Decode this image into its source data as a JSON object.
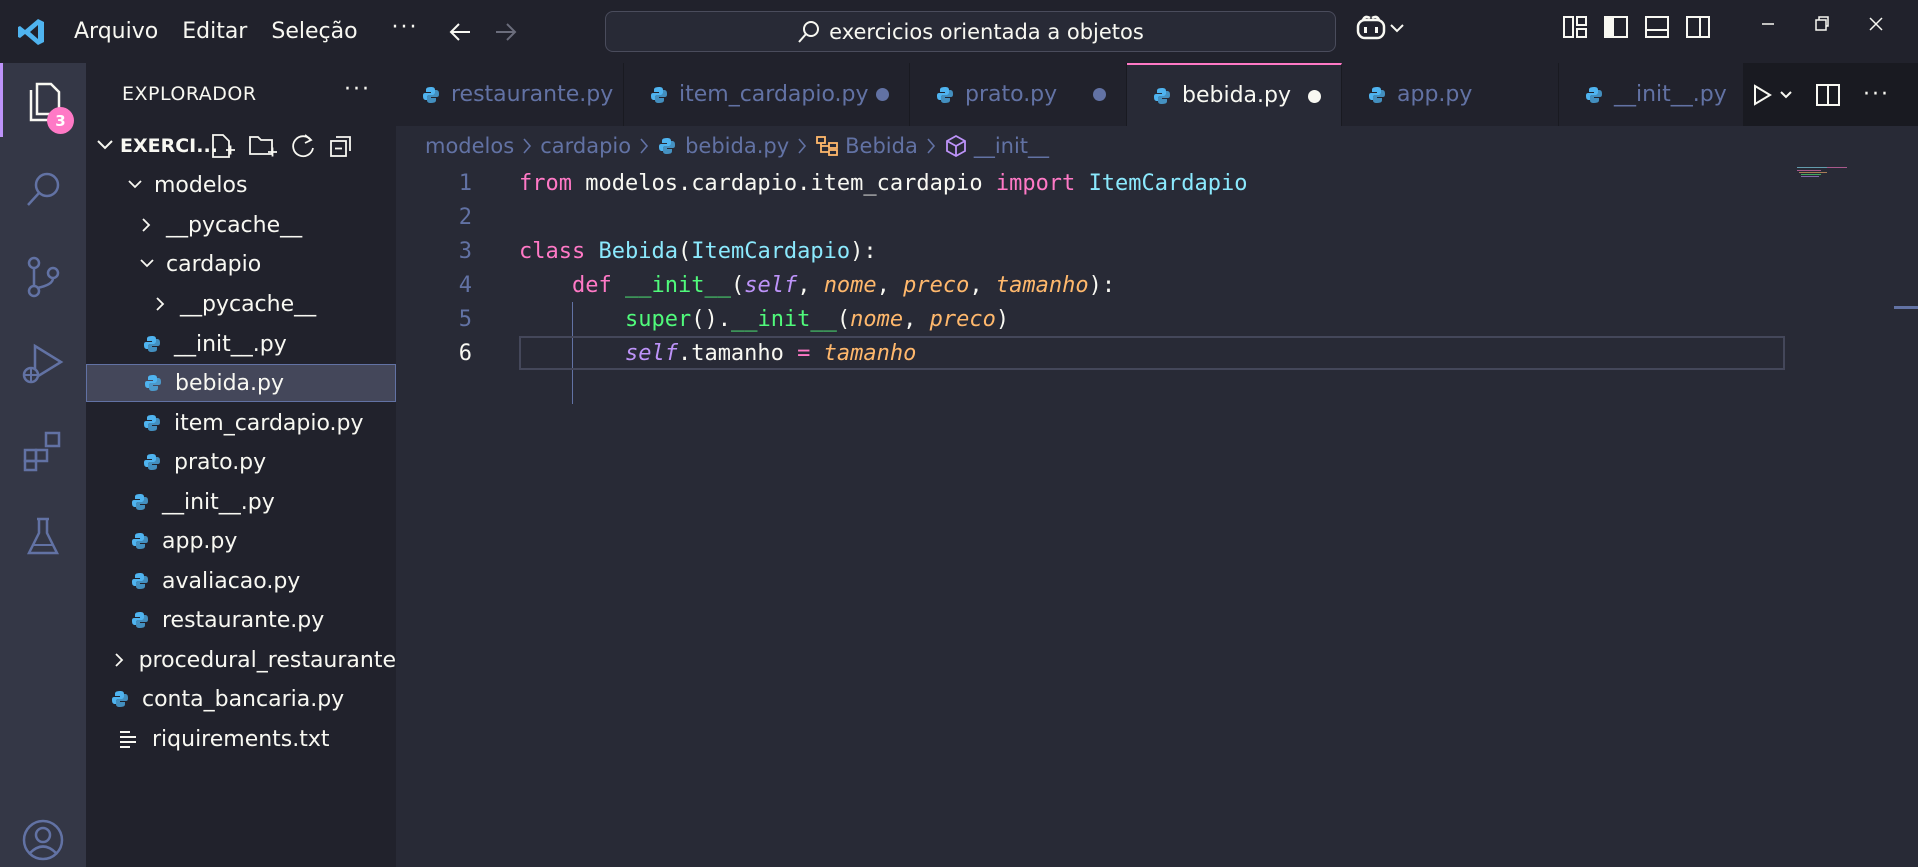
{
  "titlebar": {
    "menu": [
      "Arquivo",
      "Editar",
      "Seleção"
    ],
    "more": "···",
    "search_text": "exercicios orientada a objetos"
  },
  "activity": {
    "explorer_badge": "3"
  },
  "sidebar": {
    "title": "EXPLORADOR",
    "more": "···",
    "section": "EXERCI...",
    "tree": [
      {
        "label": "modelos",
        "type": "folder-open"
      },
      {
        "label": "__pycache__",
        "type": "folder"
      },
      {
        "label": "cardapio",
        "type": "folder-open"
      },
      {
        "label": "__pycache__",
        "type": "folder"
      },
      {
        "label": "__init__.py",
        "type": "py"
      },
      {
        "label": "bebida.py",
        "type": "py",
        "selected": true
      },
      {
        "label": "item_cardapio.py",
        "type": "py"
      },
      {
        "label": "prato.py",
        "type": "py"
      },
      {
        "label": "__init__.py",
        "type": "py"
      },
      {
        "label": "app.py",
        "type": "py"
      },
      {
        "label": "avaliacao.py",
        "type": "py"
      },
      {
        "label": "restaurante.py",
        "type": "py"
      },
      {
        "label": "procedural_restaurante",
        "type": "folder"
      },
      {
        "label": "conta_bancaria.py",
        "type": "py"
      },
      {
        "label": "riquirements.txt",
        "type": "txt"
      }
    ]
  },
  "tabs": [
    {
      "label": "restaurante.py",
      "modified": false,
      "active": false
    },
    {
      "label": "item_cardapio.py",
      "modified": true,
      "active": false
    },
    {
      "label": "prato.py",
      "modified": true,
      "active": false
    },
    {
      "label": "bebida.py",
      "modified": true,
      "active": true
    },
    {
      "label": "app.py",
      "modified": false,
      "active": false
    },
    {
      "label": "__init__.py",
      "modified": false,
      "active": false
    }
  ],
  "breadcrumb": [
    "modelos",
    "cardapio",
    "bebida.py",
    "Bebida",
    "__init__"
  ],
  "editor": {
    "line_numbers": [
      "1",
      "2",
      "3",
      "4",
      "5",
      "6"
    ],
    "current_line": 6,
    "tokens": {
      "l1": [
        "from",
        " modelos.cardapio.item_cardapio ",
        "import",
        " ",
        "ItemCardapio"
      ],
      "l3": [
        "class",
        " ",
        "Bebida",
        "(",
        "ItemCardapio",
        "):"
      ],
      "l4": [
        "    ",
        "def",
        " ",
        "__init__",
        "(",
        "self",
        ", ",
        "nome",
        ", ",
        "preco",
        ", ",
        "tamanho",
        "):"
      ],
      "l5": [
        "        ",
        "super",
        "().",
        "__init__",
        "(",
        "nome",
        ", ",
        "preco",
        ")"
      ],
      "l6": [
        "        ",
        "self",
        ".tamanho ",
        "=",
        " ",
        "tamanho"
      ]
    }
  },
  "colors": {
    "background": "#282a36",
    "sidebar": "#21222c",
    "accent": "#ff79c6",
    "keyword": "#ff79c6",
    "class": "#8be9fd",
    "function": "#50fa7b",
    "param": "#ffb86c",
    "self": "#bd93f9"
  }
}
